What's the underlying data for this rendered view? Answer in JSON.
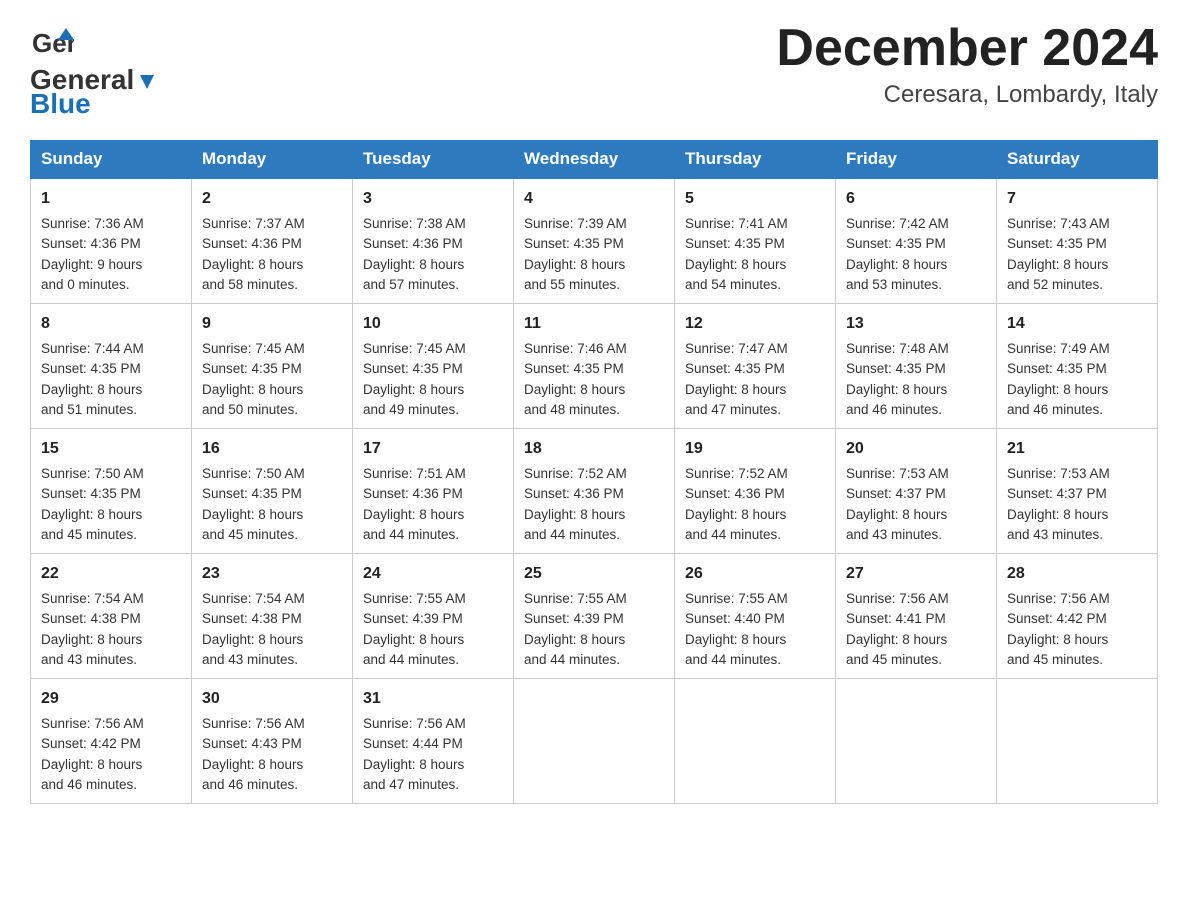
{
  "header": {
    "logo_general": "General",
    "logo_blue": "Blue",
    "month_title": "December 2024",
    "location": "Ceresara, Lombardy, Italy"
  },
  "days_of_week": [
    "Sunday",
    "Monday",
    "Tuesday",
    "Wednesday",
    "Thursday",
    "Friday",
    "Saturday"
  ],
  "weeks": [
    [
      {
        "day": "1",
        "sunrise": "7:36 AM",
        "sunset": "4:36 PM",
        "daylight_hours": "9 hours",
        "daylight_minutes": "0 minutes"
      },
      {
        "day": "2",
        "sunrise": "7:37 AM",
        "sunset": "4:36 PM",
        "daylight_hours": "8 hours",
        "daylight_minutes": "58 minutes"
      },
      {
        "day": "3",
        "sunrise": "7:38 AM",
        "sunset": "4:36 PM",
        "daylight_hours": "8 hours",
        "daylight_minutes": "57 minutes"
      },
      {
        "day": "4",
        "sunrise": "7:39 AM",
        "sunset": "4:35 PM",
        "daylight_hours": "8 hours",
        "daylight_minutes": "55 minutes"
      },
      {
        "day": "5",
        "sunrise": "7:41 AM",
        "sunset": "4:35 PM",
        "daylight_hours": "8 hours",
        "daylight_minutes": "54 minutes"
      },
      {
        "day": "6",
        "sunrise": "7:42 AM",
        "sunset": "4:35 PM",
        "daylight_hours": "8 hours",
        "daylight_minutes": "53 minutes"
      },
      {
        "day": "7",
        "sunrise": "7:43 AM",
        "sunset": "4:35 PM",
        "daylight_hours": "8 hours",
        "daylight_minutes": "52 minutes"
      }
    ],
    [
      {
        "day": "8",
        "sunrise": "7:44 AM",
        "sunset": "4:35 PM",
        "daylight_hours": "8 hours",
        "daylight_minutes": "51 minutes"
      },
      {
        "day": "9",
        "sunrise": "7:45 AM",
        "sunset": "4:35 PM",
        "daylight_hours": "8 hours",
        "daylight_minutes": "50 minutes"
      },
      {
        "day": "10",
        "sunrise": "7:45 AM",
        "sunset": "4:35 PM",
        "daylight_hours": "8 hours",
        "daylight_minutes": "49 minutes"
      },
      {
        "day": "11",
        "sunrise": "7:46 AM",
        "sunset": "4:35 PM",
        "daylight_hours": "8 hours",
        "daylight_minutes": "48 minutes"
      },
      {
        "day": "12",
        "sunrise": "7:47 AM",
        "sunset": "4:35 PM",
        "daylight_hours": "8 hours",
        "daylight_minutes": "47 minutes"
      },
      {
        "day": "13",
        "sunrise": "7:48 AM",
        "sunset": "4:35 PM",
        "daylight_hours": "8 hours",
        "daylight_minutes": "46 minutes"
      },
      {
        "day": "14",
        "sunrise": "7:49 AM",
        "sunset": "4:35 PM",
        "daylight_hours": "8 hours",
        "daylight_minutes": "46 minutes"
      }
    ],
    [
      {
        "day": "15",
        "sunrise": "7:50 AM",
        "sunset": "4:35 PM",
        "daylight_hours": "8 hours",
        "daylight_minutes": "45 minutes"
      },
      {
        "day": "16",
        "sunrise": "7:50 AM",
        "sunset": "4:35 PM",
        "daylight_hours": "8 hours",
        "daylight_minutes": "45 minutes"
      },
      {
        "day": "17",
        "sunrise": "7:51 AM",
        "sunset": "4:36 PM",
        "daylight_hours": "8 hours",
        "daylight_minutes": "44 minutes"
      },
      {
        "day": "18",
        "sunrise": "7:52 AM",
        "sunset": "4:36 PM",
        "daylight_hours": "8 hours",
        "daylight_minutes": "44 minutes"
      },
      {
        "day": "19",
        "sunrise": "7:52 AM",
        "sunset": "4:36 PM",
        "daylight_hours": "8 hours",
        "daylight_minutes": "44 minutes"
      },
      {
        "day": "20",
        "sunrise": "7:53 AM",
        "sunset": "4:37 PM",
        "daylight_hours": "8 hours",
        "daylight_minutes": "43 minutes"
      },
      {
        "day": "21",
        "sunrise": "7:53 AM",
        "sunset": "4:37 PM",
        "daylight_hours": "8 hours",
        "daylight_minutes": "43 minutes"
      }
    ],
    [
      {
        "day": "22",
        "sunrise": "7:54 AM",
        "sunset": "4:38 PM",
        "daylight_hours": "8 hours",
        "daylight_minutes": "43 minutes"
      },
      {
        "day": "23",
        "sunrise": "7:54 AM",
        "sunset": "4:38 PM",
        "daylight_hours": "8 hours",
        "daylight_minutes": "43 minutes"
      },
      {
        "day": "24",
        "sunrise": "7:55 AM",
        "sunset": "4:39 PM",
        "daylight_hours": "8 hours",
        "daylight_minutes": "44 minutes"
      },
      {
        "day": "25",
        "sunrise": "7:55 AM",
        "sunset": "4:39 PM",
        "daylight_hours": "8 hours",
        "daylight_minutes": "44 minutes"
      },
      {
        "day": "26",
        "sunrise": "7:55 AM",
        "sunset": "4:40 PM",
        "daylight_hours": "8 hours",
        "daylight_minutes": "44 minutes"
      },
      {
        "day": "27",
        "sunrise": "7:56 AM",
        "sunset": "4:41 PM",
        "daylight_hours": "8 hours",
        "daylight_minutes": "45 minutes"
      },
      {
        "day": "28",
        "sunrise": "7:56 AM",
        "sunset": "4:42 PM",
        "daylight_hours": "8 hours",
        "daylight_minutes": "45 minutes"
      }
    ],
    [
      {
        "day": "29",
        "sunrise": "7:56 AM",
        "sunset": "4:42 PM",
        "daylight_hours": "8 hours",
        "daylight_minutes": "46 minutes"
      },
      {
        "day": "30",
        "sunrise": "7:56 AM",
        "sunset": "4:43 PM",
        "daylight_hours": "8 hours",
        "daylight_minutes": "46 minutes"
      },
      {
        "day": "31",
        "sunrise": "7:56 AM",
        "sunset": "4:44 PM",
        "daylight_hours": "8 hours",
        "daylight_minutes": "47 minutes"
      },
      null,
      null,
      null,
      null
    ]
  ],
  "labels": {
    "sunrise": "Sunrise:",
    "sunset": "Sunset:",
    "daylight": "Daylight:",
    "and": "and"
  }
}
